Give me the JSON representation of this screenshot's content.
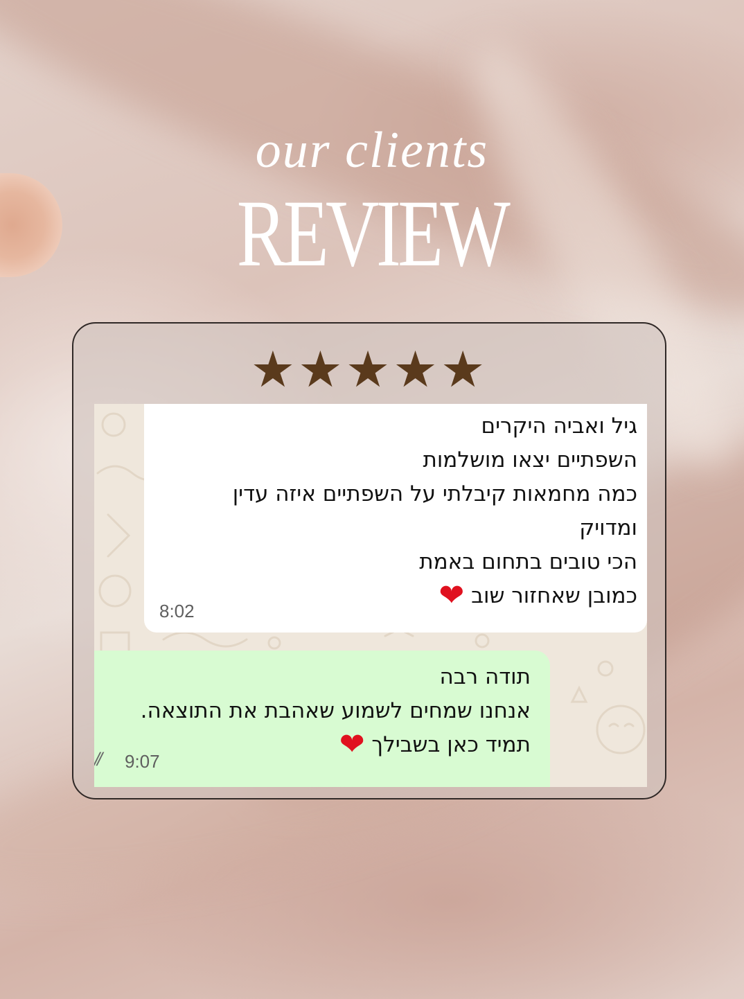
{
  "header": {
    "subtitle": "our clients",
    "title": "REVIEW"
  },
  "rating": {
    "stars": "★★★★★",
    "value": 5,
    "max": 5,
    "color": "#5a3a1c"
  },
  "chat": {
    "received": {
      "lines": [
        "גיל ואביה היקרים",
        "השפתיים יצאו מושלמות",
        "כמה מחמאות קיבלתי על השפתיים איזה עדין",
        "ומדויק",
        "הכי טובים בתחום באמת",
        "כמובן שאחזור שוב"
      ],
      "emoji": "❤",
      "time": "8:02",
      "bubble_color": "#ffffff"
    },
    "sent": {
      "lines": [
        "תודה רבה",
        "אנחנו שמחים לשמוע שאהבת את התוצאה.",
        "תמיד כאן בשבילך"
      ],
      "emoji": "❤",
      "time": "9:07",
      "read_ticks": "//",
      "bubble_color": "#d8fbd2"
    }
  }
}
